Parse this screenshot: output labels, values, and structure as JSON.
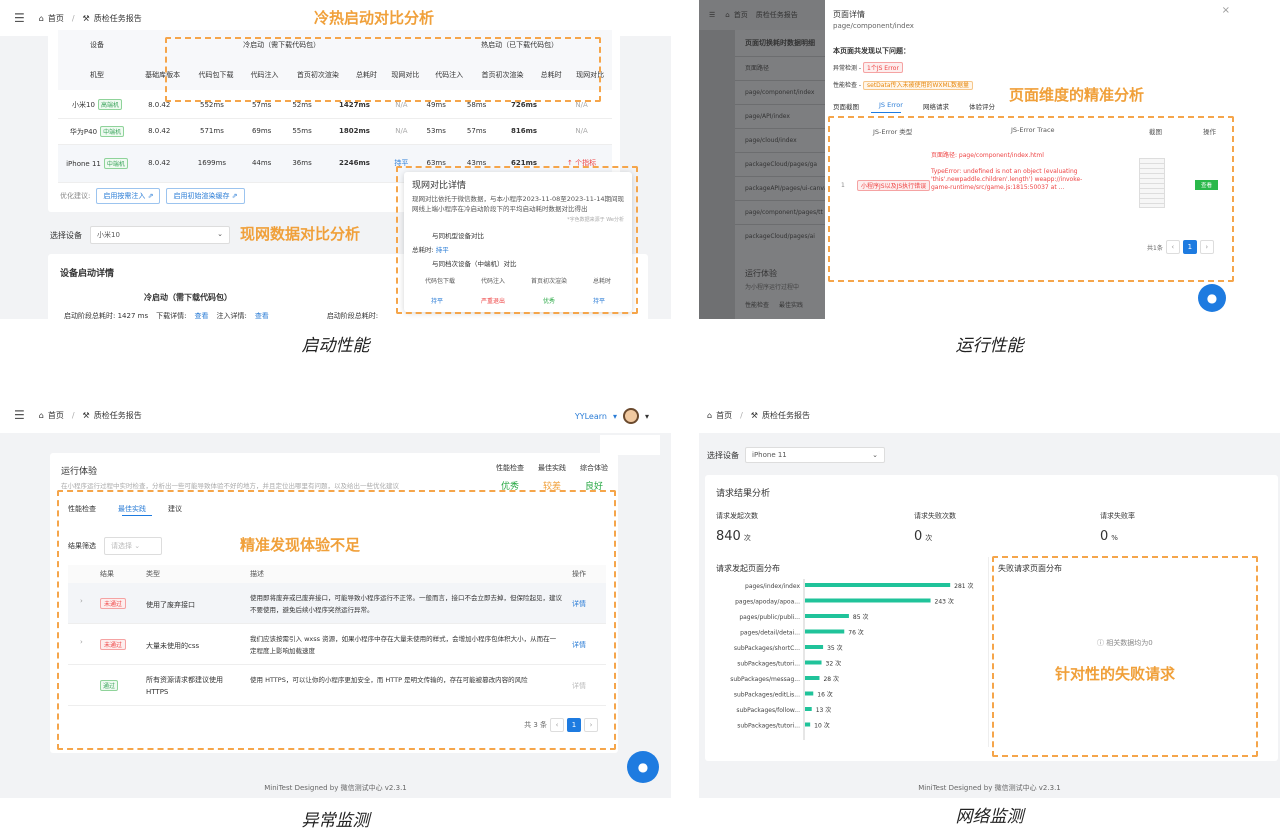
{
  "captions": {
    "p1": "启动性能",
    "p2": "运行性能",
    "p3": "异常监测",
    "p4": "网络监测"
  },
  "annotations": {
    "p1_a": "冷热启动对比分析",
    "p1_b": "现网数据对比分析",
    "p2_a": "页面维度的精准分析",
    "p3_a": "精准发现体验不足",
    "p4_a": "针对性的失败请求"
  },
  "nav": {
    "home": "首页",
    "report": "质检任务报告",
    "user": "YYLearn"
  },
  "p1": {
    "head_device": "设备",
    "head_model": "机型",
    "cold_title": "冷启动（需下载代码包）",
    "hot_title": "热启动（已下载代码包）",
    "cols": [
      "基础库版本",
      "代码包下载",
      "代码注入",
      "首页初次渲染",
      "总耗时",
      "现网对比",
      "代码注入",
      "首页初次渲染",
      "总耗时",
      "现网对比"
    ],
    "rows": [
      {
        "model": "小米10",
        "tag": "高端机",
        "v": [
          "8.0.42",
          "552ms",
          "57ms",
          "52ms",
          "1427ms",
          "N/A",
          "49ms",
          "58ms",
          "726ms",
          "N/A"
        ]
      },
      {
        "model": "华为P40",
        "tag": "中端机",
        "v": [
          "8.0.42",
          "571ms",
          "69ms",
          "55ms",
          "1802ms",
          "N/A",
          "53ms",
          "57ms",
          "816ms",
          "N/A"
        ]
      },
      {
        "model": "iPhone 11",
        "tag": "中端机",
        "v": [
          "8.0.42",
          "1699ms",
          "44ms",
          "36ms",
          "2246ms",
          "持平",
          "63ms",
          "43ms",
          "621ms",
          "↑ 个指标"
        ]
      }
    ],
    "opt_label": "优化建议:",
    "opt_b1": "启用按需注入 ⇗",
    "opt_b2": "启用初始渲染缓存 ⇗",
    "sel_label": "选择设备",
    "sel_value": "小米10",
    "detail_title": "设备启动详情",
    "cold_sub": "冷启动（需下载代码包）",
    "stage_total": "启动阶段总耗时:  1427 ms",
    "dl_detail": "下载详情:",
    "dl_link": "查看",
    "inj_detail": "注入详情:",
    "inj_link": "查看",
    "stage_total2": "启动阶段总耗时:",
    "pop_title": "现网对比详情",
    "pop_text": "现网对比依托于微信数据，与本小程序2023-11-08至2023-11-14期间现网线上端小程序在冷启动阶段下的平均启动耗时数据对比得出",
    "pop_note": "*字色数据来源于 We分析",
    "pop_sec1": "与同机型设备对比",
    "pop_total_label": "总耗时:",
    "pop_total_val": "持平",
    "pop_sec2": "与同档次设备（中端机）对比",
    "pop_cols": [
      "代码包下载",
      "代码注入",
      "首页初次渲染",
      "总耗时"
    ],
    "pop_vals": [
      "持平",
      "严重退出",
      "优秀",
      "持平"
    ]
  },
  "p2": {
    "bg_title": "页面切换耗时数据明细",
    "bg_items": [
      "页面路径",
      "page/component/index",
      "page/API/index",
      "page/cloud/index",
      "packageCloud/pages/ga",
      "packageAPI/pages/ui-canvas/ex-change",
      "page/component/pages/tt",
      "packageCloud/pages/ai"
    ],
    "run_label": "运行体验",
    "run_sub": "为小程序运行过程中",
    "side_tab1": "性能检查",
    "side_tab2": "最佳实践",
    "dlg_title": "页面详情",
    "dlg_path": "page/component/index",
    "found": "本页面共发现以下问题：",
    "issue1_label": "异常检测 -",
    "issue1_val": "1个JS Error",
    "issue2_label": "性能检查 -",
    "issue2_val": "setData传入未被使用的WXML数据量",
    "tabs": [
      "页面截图",
      "JS Error",
      "网络请求",
      "体验评分"
    ],
    "th": [
      "JS-Error 类型",
      "JS-Error Trace",
      "截图",
      "操作"
    ],
    "row_idx": "1",
    "row_type": "小程序JS以及JS执行错误",
    "trace_title": "页面路径: page/component/index.html",
    "trace_body": "TypeError: undefined is not an object (evaluating 'this'.newpaddle.children'.length') weapp://invoke-game-runtime/src/game.js:1815:50037 at ...",
    "row_btn": "查看",
    "total": "共1条",
    "page": "1"
  },
  "p3": {
    "run_title": "运行体验",
    "run_sub": "在小程序运行过程中实时检查，分析出一些可能导致体验不好的地方，并且定位出哪里有问题，以及给出一些优化建议",
    "scores": [
      {
        "label": "性能检查",
        "val": "优秀"
      },
      {
        "label": "最佳实践",
        "val": "较差"
      },
      {
        "label": "综合体验",
        "val": "良好"
      }
    ],
    "tabs": [
      "性能检查",
      "最佳实践",
      "建议"
    ],
    "filter_label": "结果筛选",
    "filter_ph": "请选择",
    "th": [
      "结果",
      "类型",
      "描述",
      "操作"
    ],
    "rows": [
      {
        "result": "未通过",
        "type": "使用了废弃接口",
        "desc": "使用即将废弃或已废弃接口，可能导致小程序运行不正常。一般而言，接口不会立即去掉，但保险起见，建议不要使用，避免后续小程序突然运行异常。",
        "op": "详情"
      },
      {
        "result": "未通过",
        "type": "大量未使用的css",
        "desc": "我们应该按需引入 wxss 资源，如果小程序中存在大量未使用的样式，会增加小程序包体积大小，从而在一定程度上影响加载速度",
        "op": "详情"
      },
      {
        "result": "通过",
        "type": "所有资源请求都建议使用HTTPS",
        "desc": "使用 HTTPS，可以让你的小程序更加安全，而 HTTP 是明文传输的，存在可能被篡改内容的风险",
        "op": "详情"
      }
    ],
    "total": "共 3 条",
    "page": "1",
    "footer": "MiniTest Designed by 微信测试中心 v2.3.1"
  },
  "p4": {
    "sel_label": "选择设备",
    "sel_value": "iPhone 11",
    "title": "请求结果分析",
    "stats": [
      {
        "label": "请求发起次数",
        "val": "840",
        "unit": "次"
      },
      {
        "label": "请求失败次数",
        "val": "0",
        "unit": "次"
      },
      {
        "label": "请求失败率",
        "val": "0",
        "unit": "%"
      }
    ],
    "dist_title": "请求发起页面分布",
    "fail_title": "失败请求页面分布",
    "no_data": "ⓘ 相关数据均为0",
    "footer": "MiniTest Designed by 微信测试中心 v2.3.1"
  },
  "chart_data": {
    "type": "bar",
    "categories": [
      "pages/index/index",
      "pages/apoday/apoa...",
      "pages/public/publi...",
      "pages/detail/detai...",
      "subPackages/shortC...",
      "subPackages/tutori...",
      "subPackages/messag...",
      "subPackages/editLis...",
      "subPackages/follow...",
      "subPackages/tutori..."
    ],
    "values": [
      281,
      243,
      85,
      76,
      35,
      32,
      28,
      16,
      13,
      10
    ],
    "unit": "次"
  },
  "colors": {
    "accent": "#f0a03a",
    "primary": "#1e7be0",
    "bar": "#20c39a"
  }
}
